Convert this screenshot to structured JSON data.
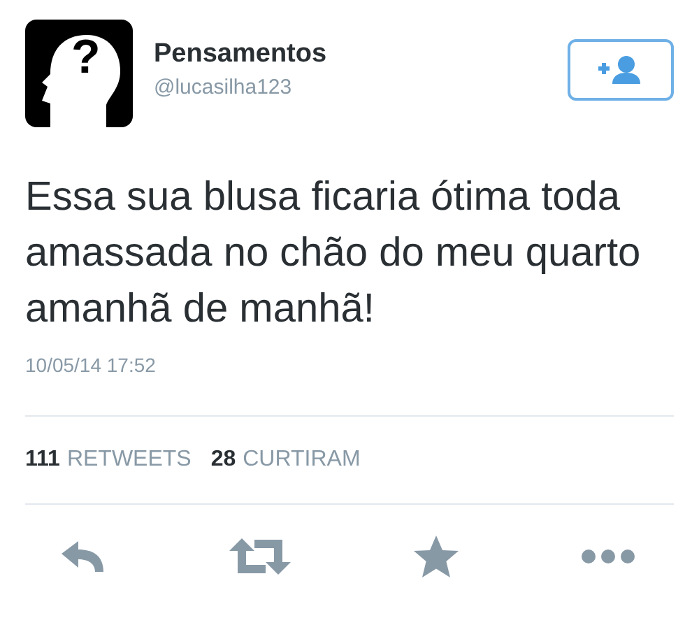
{
  "author": {
    "name": "Pensamentos",
    "handle": "@lucasilha123",
    "avatar_mark": "?"
  },
  "tweet": {
    "text": "Essa sua blusa ficaria ótima toda amassada no chão do meu quarto amanhã de manhã!",
    "timestamp": "10/05/14 17:52"
  },
  "stats": [
    {
      "count": "111",
      "label": "RETWEETS"
    },
    {
      "count": "28",
      "label": "CURTIRAM"
    }
  ],
  "actions": [
    {
      "kind": "reply"
    },
    {
      "kind": "retweet"
    },
    {
      "kind": "favorite"
    },
    {
      "kind": "more"
    }
  ]
}
